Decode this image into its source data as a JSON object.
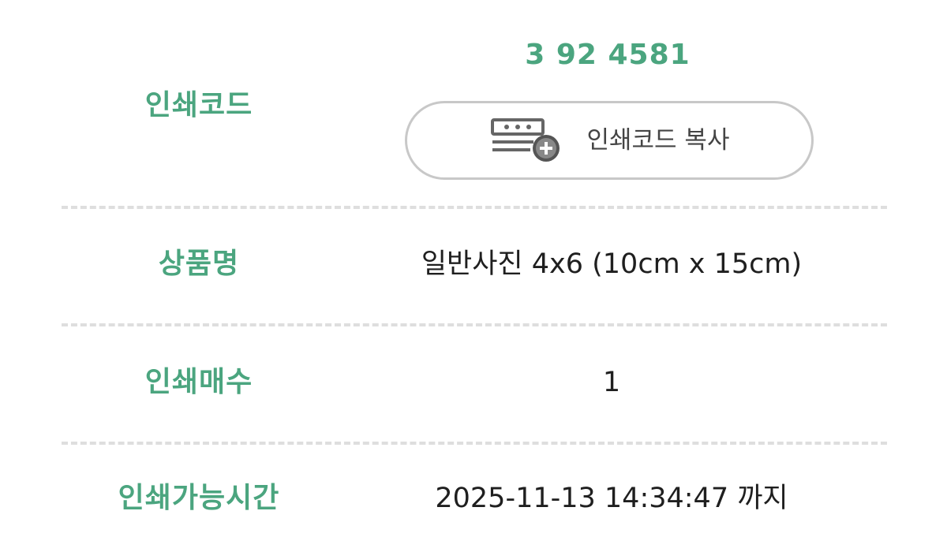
{
  "print_code": {
    "label": "인쇄코드",
    "value": "3 92 4581",
    "copy_button_label": "인쇄코드 복사",
    "copy_icon": "code-plus-icon"
  },
  "product": {
    "label": "상품명",
    "value": "일반사진 4x6 (10cm x 15cm)"
  },
  "quantity": {
    "label": "인쇄매수",
    "value": "1"
  },
  "print_time": {
    "label": "인쇄가능시간",
    "value": "2025-11-13 14:34:47 까지"
  },
  "colors": {
    "accent": "#4ba57f",
    "text": "#1f1f1f",
    "button_border": "#c8c8c8",
    "divider": "#dedede"
  }
}
